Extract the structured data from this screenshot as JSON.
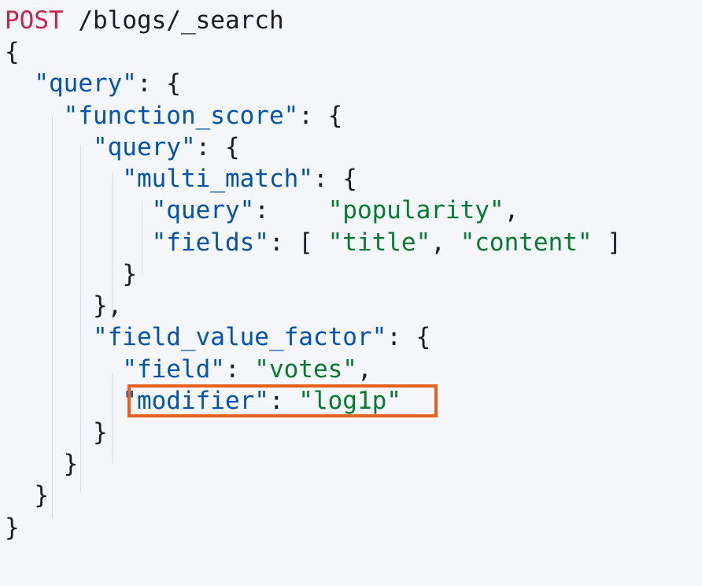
{
  "request": {
    "method": "POST",
    "path": "/blogs/_search"
  },
  "body": {
    "open_brace": "{",
    "query_key": "\"query\"",
    "function_score_key": "\"function_score\"",
    "inner_query_key": "\"query\"",
    "multi_match_key": "\"multi_match\"",
    "mm_query_key": "\"query\"",
    "mm_query_value": "\"popularity\"",
    "fields_key": "\"fields\"",
    "fields_values": [
      "\"title\"",
      "\"content\""
    ],
    "field_value_factor_key": "\"field_value_factor\"",
    "field_key": "\"field\"",
    "field_value": "\"votes\"",
    "modifier_key": "\"modifier\"",
    "modifier_value": "\"log1p\"",
    "close_brace": "}",
    "close_brace_comma": "},"
  },
  "highlight": {
    "color": "#e5611c",
    "target": "modifier-line"
  },
  "colors": {
    "background": "#f5f6f9",
    "method": "#c7254e",
    "key": "#0054b0",
    "string": "#017d2f",
    "guide": "#d3dae6"
  }
}
